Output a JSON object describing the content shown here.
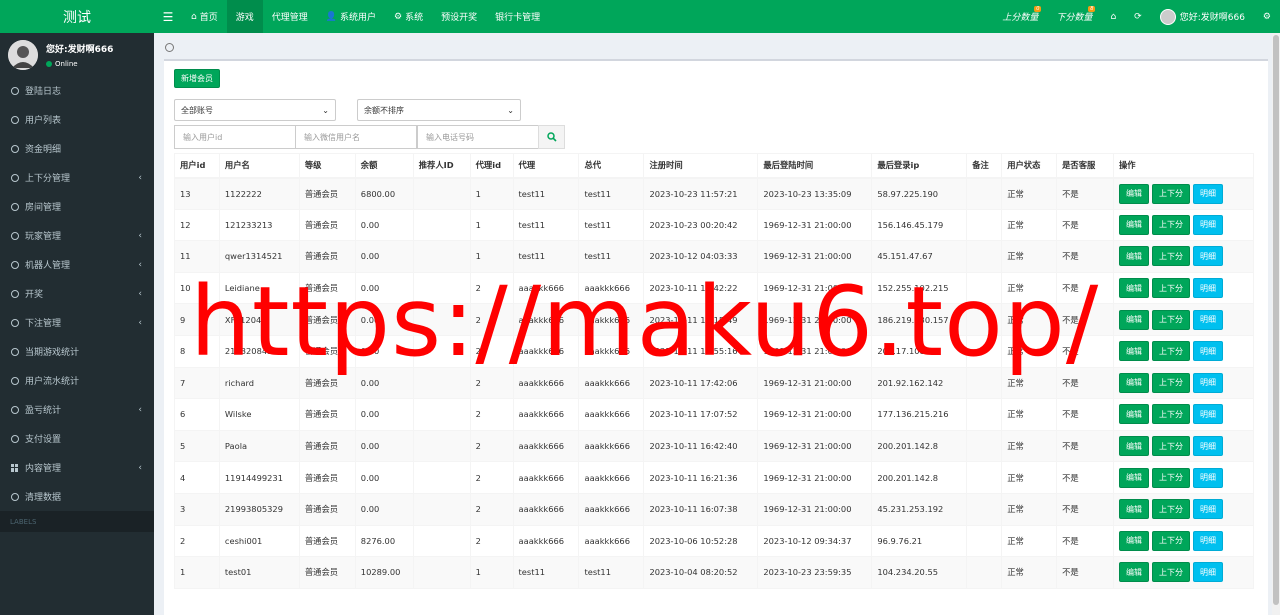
{
  "app": {
    "title": "测试"
  },
  "topnav": [
    {
      "label": "首页",
      "icon": "home-icon"
    },
    {
      "label": "游戏",
      "active": true
    },
    {
      "label": "代理管理"
    },
    {
      "label": "系统用户",
      "icon": "user-icon"
    },
    {
      "label": "系统",
      "icon": "gear-icon"
    },
    {
      "label": "预设开奖"
    },
    {
      "label": "银行卡管理"
    }
  ],
  "topright": {
    "score_up": "上分数量",
    "score_up_badge": "0",
    "score_down": "下分数量",
    "score_down_badge": "8",
    "user": "您好:发财啊666"
  },
  "sidebar": {
    "user_name": "您好:发财啊666",
    "status": "Online",
    "labels": "LABELS",
    "items": [
      {
        "label": "登陆日志"
      },
      {
        "label": "用户列表"
      },
      {
        "label": "资金明细"
      },
      {
        "label": "上下分管理",
        "chevron": true
      },
      {
        "label": "房间管理"
      },
      {
        "label": "玩家管理",
        "chevron": true
      },
      {
        "label": "机器人管理",
        "chevron": true
      },
      {
        "label": "开奖",
        "chevron": true
      },
      {
        "label": "下注管理",
        "chevron": true
      },
      {
        "label": "当期游戏统计"
      },
      {
        "label": "用户流水统计"
      },
      {
        "label": "盈亏统计",
        "chevron": true
      },
      {
        "label": "支付设置"
      },
      {
        "label": "内容管理",
        "chevron": true,
        "icon": "grid"
      },
      {
        "label": "清理数据"
      }
    ]
  },
  "toolbar": {
    "add_label": "新增会员",
    "account_select": "全部账号",
    "sort_select": "余额不排序",
    "uid_placeholder": "输入用户id",
    "wechat_placeholder": "输入微信用户名",
    "phone_placeholder": "输入电话号码"
  },
  "table": {
    "headers": [
      "用户id",
      "用户名",
      "等级",
      "余额",
      "推荐人ID",
      "代理id",
      "代理",
      "总代",
      "注册时间",
      "最后登陆时间",
      "最后登录ip",
      "备注",
      "用户状态",
      "是否客服",
      "操作"
    ],
    "actions": [
      "编辑",
      "上下分",
      "明细"
    ],
    "rows": [
      [
        "13",
        "1122222",
        "普通会员",
        "6800.00",
        "",
        "1",
        "test11",
        "test11",
        "2023-10-23 11:57:21",
        "2023-10-23 13:35:09",
        "58.97.225.190",
        "",
        "正常",
        "不是"
      ],
      [
        "12",
        "121233213",
        "普通会员",
        "0.00",
        "",
        "1",
        "test11",
        "test11",
        "2023-10-23 00:20:42",
        "1969-12-31 21:00:00",
        "156.146.45.179",
        "",
        "正常",
        "不是"
      ],
      [
        "11",
        "qwer1314521",
        "普通会员",
        "0.00",
        "",
        "1",
        "test11",
        "test11",
        "2023-10-12 04:03:33",
        "1969-12-31 21:00:00",
        "45.151.47.67",
        "",
        "正常",
        "不是"
      ],
      [
        "10",
        "Leidiane",
        "普通会员",
        "0.00",
        "",
        "2",
        "aaakkk666",
        "aaakkk666",
        "2023-10-11 18:42:22",
        "1969-12-31 21:00:00",
        "152.255.102.215",
        "",
        "正常",
        "不是"
      ],
      [
        "9",
        "XFF1204",
        "普通会员",
        "0.00",
        "",
        "2",
        "aaakkk666",
        "aaakkk666",
        "2023-10-11 18:15:49",
        "1969-12-31 21:00:00",
        "186.219.130.157",
        "",
        "正常",
        "不是"
      ],
      [
        "8",
        "21132084315",
        "普通会员",
        "0.00",
        "",
        "2",
        "aaakkk666",
        "aaakkk666",
        "2023-10-11 17:55:16",
        "1969-12-31 21:00:00",
        "201.17.108.1",
        "",
        "正常",
        "不是"
      ],
      [
        "7",
        "richard",
        "普通会员",
        "0.00",
        "",
        "2",
        "aaakkk666",
        "aaakkk666",
        "2023-10-11 17:42:06",
        "1969-12-31 21:00:00",
        "201.92.162.142",
        "",
        "正常",
        "不是"
      ],
      [
        "6",
        "Wilske",
        "普通会员",
        "0.00",
        "",
        "2",
        "aaakkk666",
        "aaakkk666",
        "2023-10-11 17:07:52",
        "1969-12-31 21:00:00",
        "177.136.215.216",
        "",
        "正常",
        "不是"
      ],
      [
        "5",
        "Paola",
        "普通会员",
        "0.00",
        "",
        "2",
        "aaakkk666",
        "aaakkk666",
        "2023-10-11 16:42:40",
        "1969-12-31 21:00:00",
        "200.201.142.8",
        "",
        "正常",
        "不是"
      ],
      [
        "4",
        "11914499231",
        "普通会员",
        "0.00",
        "",
        "2",
        "aaakkk666",
        "aaakkk666",
        "2023-10-11 16:21:36",
        "1969-12-31 21:00:00",
        "200.201.142.8",
        "",
        "正常",
        "不是"
      ],
      [
        "3",
        "21993805329",
        "普通会员",
        "0.00",
        "",
        "2",
        "aaakkk666",
        "aaakkk666",
        "2023-10-11 16:07:38",
        "1969-12-31 21:00:00",
        "45.231.253.192",
        "",
        "正常",
        "不是"
      ],
      [
        "2",
        "ceshi001",
        "普通会员",
        "8276.00",
        "",
        "2",
        "aaakkk666",
        "aaakkk666",
        "2023-10-06 10:52:28",
        "2023-10-12 09:34:37",
        "96.9.76.21",
        "",
        "正常",
        "不是"
      ],
      [
        "1",
        "test01",
        "普通会员",
        "10289.00",
        "",
        "1",
        "test11",
        "test11",
        "2023-10-04 08:20:52",
        "2023-10-23 23:59:35",
        "104.234.20.55",
        "",
        "正常",
        "不是"
      ]
    ]
  },
  "watermark": "https://maku6.top/",
  "colors": {
    "brand": "#00a65a",
    "sidebar": "#222d32",
    "info": "#00c0ef"
  }
}
